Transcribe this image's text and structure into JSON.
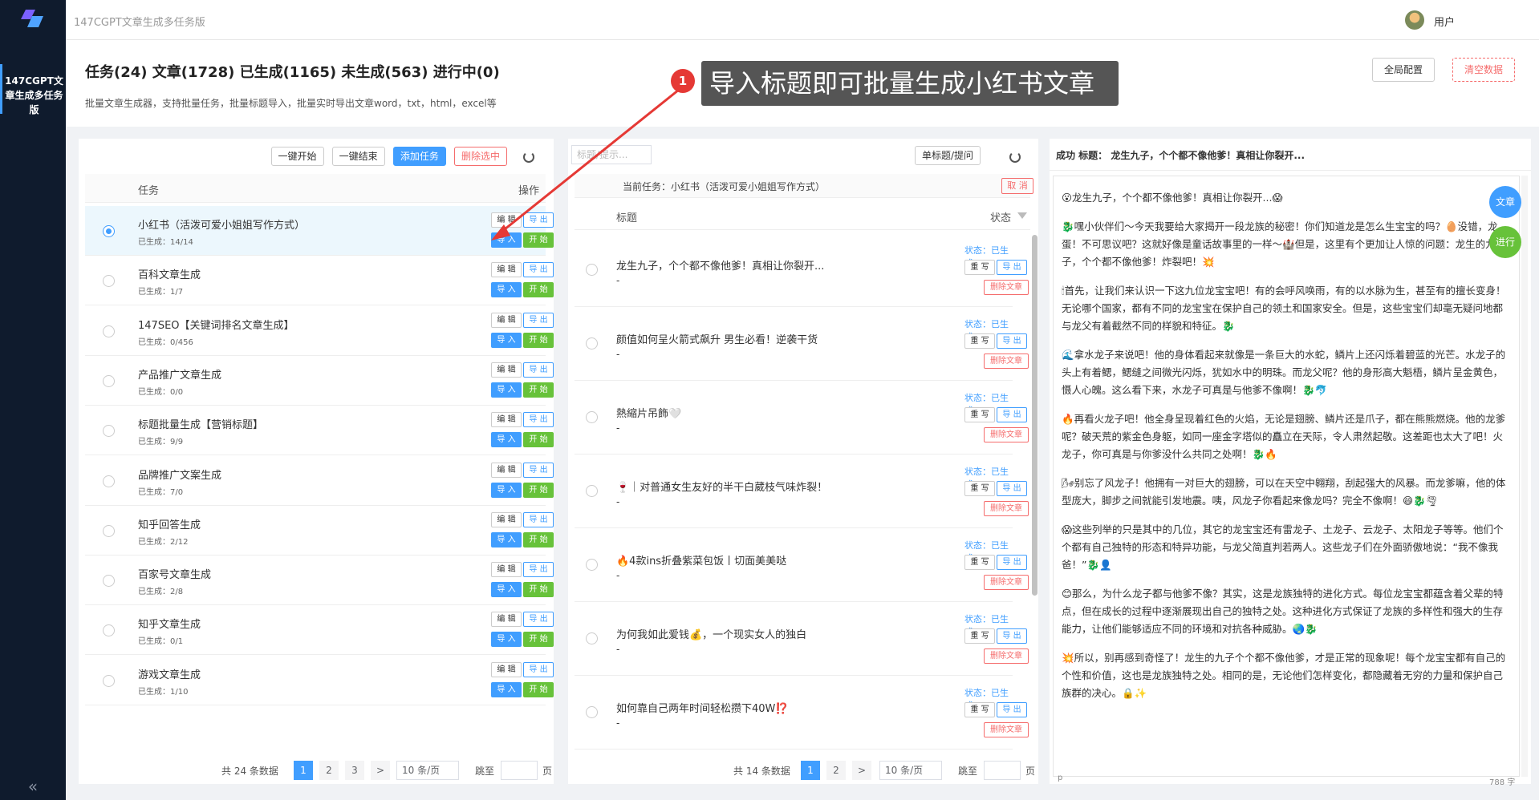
{
  "app": {
    "title": "147CGPT文章生成多任务版",
    "side_label": "147CGPT文章生成多任务版",
    "collapse_icon": "«",
    "user": "用户"
  },
  "header": {
    "stats": "任务(24) 文章(1728) 已生成(1165) 未生成(563) 进行中(0)",
    "desc": "批量文章生成器，支持批量任务，批量标题导入，批量实时导出文章word，txt，html，excel等",
    "global_config": "全局配置",
    "clear_data": "清空数据"
  },
  "annotation": {
    "num": "1",
    "text": "导入标题即可批量生成小红书文章"
  },
  "tasks_panel": {
    "btn_start_all": "一键开始",
    "btn_end_all": "一键结束",
    "btn_add": "添加任务",
    "btn_delete": "删除选中",
    "col_task": "任务",
    "col_op": "操作",
    "btn_edit": "编 辑",
    "btn_export": "导 出",
    "btn_import": "导 入",
    "btn_start": "开 始",
    "rows": [
      {
        "name": "小红书（活泼可爱小姐姐写作方式）",
        "sub": "已生成：14/14",
        "selected": true
      },
      {
        "name": "百科文章生成",
        "sub": "已生成：1/7"
      },
      {
        "name": "147SEO【关键词排名文章生成】",
        "sub": "已生成：0/456"
      },
      {
        "name": "产品推广文章生成",
        "sub": "已生成：0/0"
      },
      {
        "name": "标题批量生成【营销标题】",
        "sub": "已生成：9/9"
      },
      {
        "name": "品牌推广文案生成",
        "sub": "已生成：7/0"
      },
      {
        "name": "知乎回答生成",
        "sub": "已生成：2/12"
      },
      {
        "name": "百家号文章生成",
        "sub": "已生成：2/8"
      },
      {
        "name": "知乎文章生成",
        "sub": "已生成：0/1"
      },
      {
        "name": "游戏文章生成",
        "sub": "已生成：1/10"
      }
    ],
    "pager": {
      "total": "共 24 条数据",
      "p1": "1",
      "p2": "2",
      "p3": "3",
      "next": ">",
      "size": "10 条/页",
      "jump": "跳至",
      "page": "页"
    }
  },
  "articles_panel": {
    "search_placeholder": "标题/提示...",
    "btn_single": "单标题/提问",
    "current_task": "当前任务：小红书（活泼可爱小姐姐写作方式）",
    "btn_cancel": "取 消",
    "col_title": "标题",
    "col_status": "状态",
    "status_text": "状态：已生成",
    "btn_rewrite": "重 写",
    "btn_export": "导 出",
    "btn_delete": "删除文章",
    "rows": [
      {
        "title": "龙生九子，个个都不像他爹！真相让你裂开...",
        "dot": "-"
      },
      {
        "title": "颜值如何呈火箭式飙升 男生必看！逆袭干货",
        "dot": "-"
      },
      {
        "title": "熱縮片吊飾🤍",
        "dot": "-"
      },
      {
        "title": "🍷｜对普通女生友好的半干白葳枝气味炸裂！",
        "dot": "-"
      },
      {
        "title": "🔥4款ins折叠紫菜包饭丨切面美美哒",
        "dot": "-"
      },
      {
        "title": "为何我如此爱钱💰，一个现实女人的独白",
        "dot": "-"
      },
      {
        "title": "如何靠自己两年时间轻松攒下40W⁉️",
        "dot": "-"
      }
    ],
    "pager": {
      "total": "共 14 条数据",
      "p1": "1",
      "p2": "2",
      "next": ">",
      "size": "10 条/页",
      "jump": "跳至",
      "page": "页"
    }
  },
  "content_panel": {
    "header": "成功 标题：  龙生九子，个个都不像他爹！真相让你裂开...",
    "float_article": "文章",
    "float_running": "进行",
    "footer_p": "p",
    "char_count": "788 字",
    "paragraphs": [
      "😮龙生九子，个个都不像他爹！真相让你裂开...😱",
      "🐉嘿小伙伴们～今天我要给大家揭开一段龙族的秘密！你们知道龙是怎么生宝宝的吗？🥚没错，龙蛋！不可思议吧？这就好像是童话故事里的一样～🏰但是，这里有个更加让人惊的问题：龙生的九子，个个都不像他爹！炸裂吧！💥",
      "🕯首先，让我们来认识一下这九位龙宝宝吧！有的会呼风唤雨，有的以水脉为生，甚至有的擅长变身！无论哪个国家，都有不同的龙宝宝在保护自己的领土和国家安全。但是，这些宝宝们却毫无疑问地都与龙父有着截然不同的样貌和特征。🐉",
      "🌊拿水龙子来说吧！他的身体看起来就像是一条巨大的水蛇，鳞片上还闪烁着碧蓝的光芒。水龙子的头上有着鳃，鳃缝之间微光闪烁，犹如水中的明珠。而龙父呢？他的身形高大魁梧，鳞片呈金黄色，慑人心魄。这么看下来，水龙子可真是与他爹不像啊！🐉🐬",
      "🔥再看火龙子吧！他全身呈现着红色的火焰，无论是翅膀、鳞片还是爪子，都在熊熊燃烧。他的龙爹呢？破天荒的紫金色身躯，如同一座金字塔似的矗立在天际，令人肃然起敬。这差距也太大了吧！火龙子，你可真是与你爹没什么共同之处啊！🐉🔥",
      "🌬别忘了风龙子！他拥有一对巨大的翅膀，可以在天空中翱翔，刮起强大的风暴。而龙爹嘛，他的体型庞大，脚步之间就能引发地震。咦，风龙子你看起来像龙吗？完全不像啊！😄🐉🌪",
      "😱这些列举的只是其中的几位，其它的龙宝宝还有雷龙子、土龙子、云龙子、太阳龙子等等。他们个个都有自己独特的形态和特异功能，与龙父简直判若两人。这些龙子们在外面骄傲地说：“我不像我爸！”🐉👤",
      "😊那么，为什么龙子都与他爹不像？其实，这是龙族独特的进化方式。每位龙宝宝都蕴含着父辈的特点，但在成长的过程中逐渐展现出自己的独特之处。这种进化方式保证了龙族的多样性和强大的生存能力，让他们能够适应不同的环境和对抗各种威胁。🌏🐉",
      "💥所以，别再感到奇怪了！龙生的九子个个都不像他爹，才是正常的现象呢！每个龙宝宝都有自己的个性和价值，这也是龙族独特之处。相同的是，无论他们怎样变化，都隐藏着无穷的力量和保护自己族群的决心。🔒✨"
    ]
  }
}
